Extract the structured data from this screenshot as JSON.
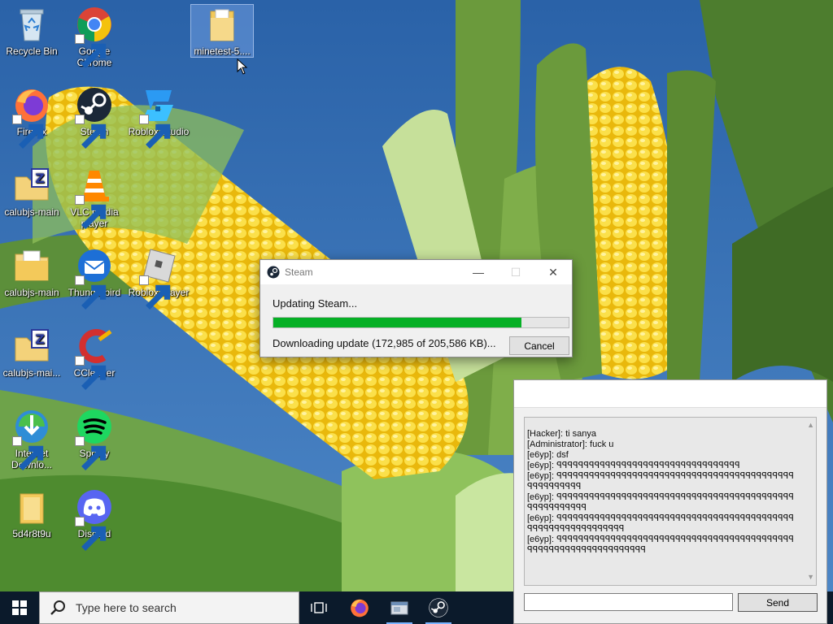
{
  "desktop": {
    "icons": [
      {
        "id": "recycle",
        "label": "Recycle Bin"
      },
      {
        "id": "chrome",
        "label": "Google Chrome"
      },
      {
        "id": "minetest",
        "label": "minetest-5...."
      },
      {
        "id": "firefox",
        "label": "Firefox"
      },
      {
        "id": "steam",
        "label": "Steam"
      },
      {
        "id": "roblox-studio",
        "label": "Roblox Studio"
      },
      {
        "id": "calubjs1",
        "label": "calubjs-main"
      },
      {
        "id": "vlc",
        "label": "VLC media player"
      },
      {
        "id": "calubjs2",
        "label": "calubjs-main"
      },
      {
        "id": "thunderbird",
        "label": "Thunderbird"
      },
      {
        "id": "roblox-player",
        "label": "Roblox Player"
      },
      {
        "id": "calubjs3",
        "label": "calubjs-mai..."
      },
      {
        "id": "ccleaner",
        "label": "CCleaner"
      },
      {
        "id": "idm",
        "label": "Internet Downlo..."
      },
      {
        "id": "spotify",
        "label": "Spotify"
      },
      {
        "id": "folder5d",
        "label": "5d4r8t9u"
      },
      {
        "id": "discord",
        "label": "Discord"
      }
    ]
  },
  "steam_dialog": {
    "title": "Steam",
    "status": "Updating Steam...",
    "progress_fraction": 0.8414,
    "detail": "Downloading update (172,985 of 205,586 KB)...",
    "cancel_label": "Cancel",
    "minimize": "—",
    "maximize": "☐",
    "close": "✕"
  },
  "chat": {
    "lines": [
      "[Hacker]: ti sanya",
      "[Administrator]: fuck u",
      "[e6yp]: dsf",
      "[e6yp]: ꟼꟼꟼꟼꟼꟼꟼꟼꟼꟼꟼꟼꟼꟼꟼꟼꟼꟼꟼꟼꟼꟼꟼꟼꟼꟼꟼꟼꟼꟼꟼꟼꟼꟼ",
      "[e6yp]: ꟼꟼꟼꟼꟼꟼꟼꟼꟼꟼꟼꟼꟼꟼꟼꟼꟼꟼꟼꟼꟼꟼꟼꟼꟼꟼꟼꟼꟼꟼꟼꟼꟼꟼꟼꟼꟼꟼꟼꟼꟼꟼꟼꟼꟼꟼꟼꟼꟼꟼꟼꟼꟼꟼ",
      "[e6yp]: ꟼꟼꟼꟼꟼꟼꟼꟼꟼꟼꟼꟼꟼꟼꟼꟼꟼꟼꟼꟼꟼꟼꟼꟼꟼꟼꟼꟼꟼꟼꟼꟼꟼꟼꟼꟼꟼꟼꟼꟼꟼꟼꟼꟼꟼꟼꟼꟼꟼꟼꟼꟼꟼꟼꟼ",
      "[e6yp]: ꟼꟼꟼꟼꟼꟼꟼꟼꟼꟼꟼꟼꟼꟼꟼꟼꟼꟼꟼꟼꟼꟼꟼꟼꟼꟼꟼꟼꟼꟼꟼꟼꟼꟼꟼꟼꟼꟼꟼꟼꟼꟼꟼꟼꟼꟼꟼꟼꟼꟼꟼꟼꟼꟼꟼꟼꟼꟼꟼꟼꟼꟼ",
      "[e6yp]: ꟼꟼꟼꟼꟼꟼꟼꟼꟼꟼꟼꟼꟼꟼꟼꟼꟼꟼꟼꟼꟼꟼꟼꟼꟼꟼꟼꟼꟼꟼꟼꟼꟼꟼꟼꟼꟼꟼꟼꟼꟼꟼꟼꟼꟼꟼꟼꟼꟼꟼꟼꟼꟼꟼꟼꟼꟼꟼꟼꟼꟼꟼꟼꟼꟼꟼ"
    ],
    "input_value": "",
    "send_label": "Send"
  },
  "taskbar": {
    "search_placeholder": "Type here to search"
  },
  "colors": {
    "progress": "#06b025",
    "taskbar": "#0b1a2b",
    "sky": "#2f6fb0",
    "corn": "#f2c418"
  }
}
